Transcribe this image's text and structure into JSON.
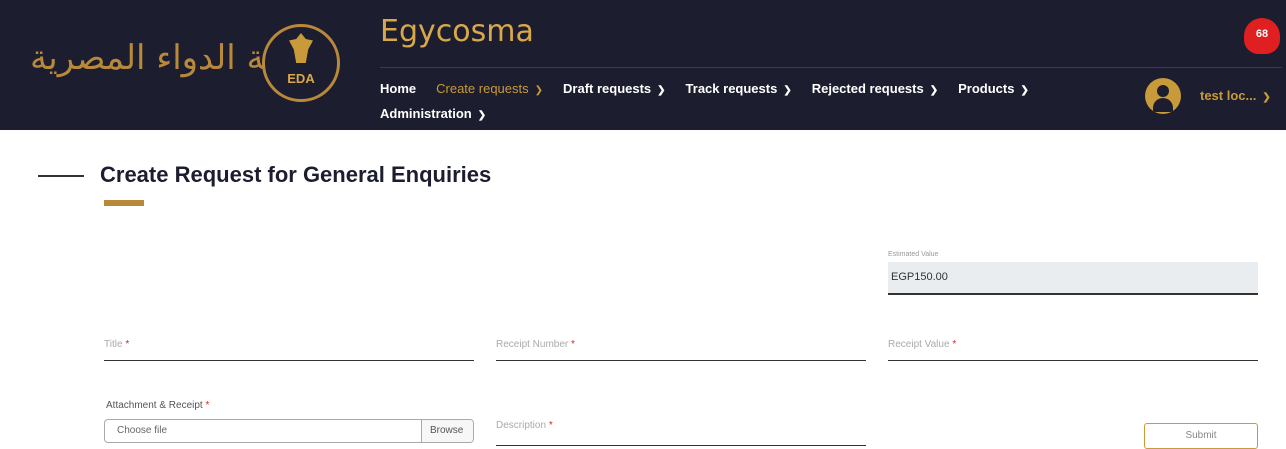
{
  "header": {
    "logo_arabic": "هيئة الدواء المصرية",
    "logo_seal_text": "EDA",
    "app_title": "Egycosma",
    "notification_count": "68",
    "user_name": "test loc...",
    "nav": [
      {
        "label": "Home"
      },
      {
        "label": "Create requests"
      },
      {
        "label": "Draft requests"
      },
      {
        "label": "Track requests"
      },
      {
        "label": "Rejected requests"
      },
      {
        "label": "Products"
      },
      {
        "label": "Administration"
      }
    ]
  },
  "page": {
    "title": "Create Request for General Enquiries"
  },
  "form": {
    "estimated_label": "Estimated Value",
    "estimated_value": "EGP150.00",
    "title_label": "Title",
    "receipt_number_label": "Receipt Number",
    "receipt_value_label": "Receipt Value",
    "required_mark": "*",
    "attachment_label": "Attachment & Receipt",
    "choose_file": "Choose file",
    "browse": "Browse",
    "description_label": "Description",
    "submit": "Submit"
  },
  "colors": {
    "header_bg": "#1c1d2e",
    "accent_gold": "#c89a3a",
    "notification_red": "#e02020"
  }
}
